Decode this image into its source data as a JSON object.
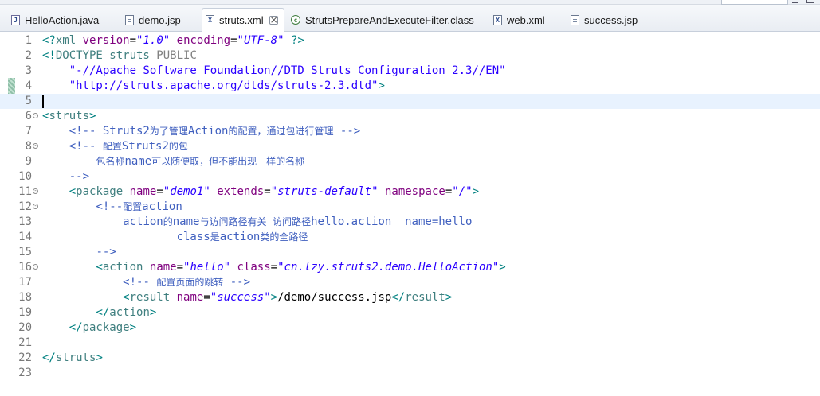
{
  "tabs": [
    {
      "label": "HelloAction.java",
      "icon": "java-file-icon",
      "active": false
    },
    {
      "label": "demo.jsp",
      "icon": "jsp-file-icon",
      "active": false
    },
    {
      "label": "struts.xml",
      "icon": "xml-file-icon",
      "active": true
    },
    {
      "label": "StrutsPrepareAndExecuteFilter.class",
      "icon": "class-file-icon",
      "active": false
    },
    {
      "label": "web.xml",
      "icon": "xml-file-icon",
      "active": false
    },
    {
      "label": "success.jsp",
      "icon": "jsp-file-icon",
      "active": false
    }
  ],
  "editor": {
    "current_line": 5,
    "lines": [
      {
        "n": "1",
        "fold": false,
        "segs": [
          [
            "t-br",
            "<?"
          ],
          [
            "t-tag",
            "xml"
          ],
          [
            "t-txt",
            " "
          ],
          [
            "t-attr",
            "version"
          ],
          [
            "t-txt",
            "="
          ],
          [
            "t-val",
            "\"1.0\""
          ],
          [
            "t-txt",
            " "
          ],
          [
            "t-attr",
            "encoding"
          ],
          [
            "t-txt",
            "="
          ],
          [
            "t-val",
            "\"UTF-8\""
          ],
          [
            "t-txt",
            " "
          ],
          [
            "t-br",
            "?>"
          ]
        ]
      },
      {
        "n": "2",
        "fold": false,
        "segs": [
          [
            "t-br",
            "<!"
          ],
          [
            "t-key",
            "DOCTYPE struts "
          ],
          [
            "t-dt",
            "PUBLIC"
          ]
        ]
      },
      {
        "n": "3",
        "fold": false,
        "segs": [
          [
            "t-txt",
            "    "
          ],
          [
            "t-str",
            "\"-//Apache Software Foundation//DTD Struts Configuration 2.3//EN\""
          ]
        ]
      },
      {
        "n": "4",
        "fold": false,
        "segs": [
          [
            "t-txt",
            "    "
          ],
          [
            "t-str",
            "\"http://struts.apache.org/dtds/struts-2.3.dtd\""
          ],
          [
            "t-br",
            ">"
          ]
        ]
      },
      {
        "n": "5",
        "fold": false,
        "segs": []
      },
      {
        "n": "6",
        "fold": true,
        "segs": [
          [
            "t-br",
            "<"
          ],
          [
            "t-tag",
            "struts"
          ],
          [
            "t-br",
            ">"
          ]
        ]
      },
      {
        "n": "7",
        "fold": false,
        "segs": [
          [
            "t-txt",
            "    "
          ],
          [
            "t-com",
            "<!-- Struts2"
          ],
          [
            "t-com cjk",
            "为了管理"
          ],
          [
            "t-com",
            "Action"
          ],
          [
            "t-com cjk",
            "的配置，通过包进行管理"
          ],
          [
            "t-com",
            " -->"
          ]
        ]
      },
      {
        "n": "8",
        "fold": true,
        "segs": [
          [
            "t-txt",
            "    "
          ],
          [
            "t-com",
            "<!-- "
          ],
          [
            "t-com cjk",
            "配置"
          ],
          [
            "t-com",
            "Struts2"
          ],
          [
            "t-com cjk",
            "的包"
          ]
        ]
      },
      {
        "n": "9",
        "fold": false,
        "segs": [
          [
            "t-txt",
            "        "
          ],
          [
            "t-com cjk",
            "包名称"
          ],
          [
            "t-com",
            "name"
          ],
          [
            "t-com cjk",
            "可以随便取，但不能出现一样的名称"
          ]
        ]
      },
      {
        "n": "10",
        "fold": false,
        "segs": [
          [
            "t-txt",
            "    "
          ],
          [
            "t-com",
            "-->"
          ]
        ]
      },
      {
        "n": "11",
        "fold": true,
        "segs": [
          [
            "t-txt",
            "    "
          ],
          [
            "t-br",
            "<"
          ],
          [
            "t-tag",
            "package"
          ],
          [
            "t-txt",
            " "
          ],
          [
            "t-attr",
            "name"
          ],
          [
            "t-txt",
            "="
          ],
          [
            "t-val",
            "\"demo1\""
          ],
          [
            "t-txt",
            " "
          ],
          [
            "t-attr",
            "extends"
          ],
          [
            "t-txt",
            "="
          ],
          [
            "t-val",
            "\"struts-default\""
          ],
          [
            "t-txt",
            " "
          ],
          [
            "t-attr",
            "namespace"
          ],
          [
            "t-txt",
            "="
          ],
          [
            "t-val",
            "\"/\""
          ],
          [
            "t-br",
            ">"
          ]
        ]
      },
      {
        "n": "12",
        "fold": true,
        "segs": [
          [
            "t-txt",
            "        "
          ],
          [
            "t-com",
            "<!--"
          ],
          [
            "t-com cjk",
            "配置"
          ],
          [
            "t-com",
            "action"
          ]
        ]
      },
      {
        "n": "13",
        "fold": false,
        "segs": [
          [
            "t-txt",
            "            "
          ],
          [
            "t-com",
            "action"
          ],
          [
            "t-com cjk",
            "的"
          ],
          [
            "t-com",
            "name"
          ],
          [
            "t-com cjk",
            "与访问路径有关  访问路径"
          ],
          [
            "t-com",
            "hello.action  name=hello"
          ]
        ]
      },
      {
        "n": "14",
        "fold": false,
        "segs": [
          [
            "t-txt",
            "                    "
          ],
          [
            "t-com",
            "class"
          ],
          [
            "t-com cjk",
            "是"
          ],
          [
            "t-com",
            "action"
          ],
          [
            "t-com cjk",
            "类的全路径"
          ]
        ]
      },
      {
        "n": "15",
        "fold": false,
        "segs": [
          [
            "t-txt",
            "        "
          ],
          [
            "t-com",
            "-->"
          ]
        ]
      },
      {
        "n": "16",
        "fold": true,
        "segs": [
          [
            "t-txt",
            "        "
          ],
          [
            "t-br",
            "<"
          ],
          [
            "t-tag",
            "action"
          ],
          [
            "t-txt",
            " "
          ],
          [
            "t-attr",
            "name"
          ],
          [
            "t-txt",
            "="
          ],
          [
            "t-val",
            "\"hello\""
          ],
          [
            "t-txt",
            " "
          ],
          [
            "t-attr",
            "class"
          ],
          [
            "t-txt",
            "="
          ],
          [
            "t-val",
            "\"cn.lzy.struts2.demo.HelloAction\""
          ],
          [
            "t-br",
            ">"
          ]
        ]
      },
      {
        "n": "17",
        "fold": false,
        "segs": [
          [
            "t-txt",
            "            "
          ],
          [
            "t-com",
            "<!-- "
          ],
          [
            "t-com cjk",
            "配置页面的跳转"
          ],
          [
            "t-com",
            " -->"
          ]
        ]
      },
      {
        "n": "18",
        "fold": false,
        "segs": [
          [
            "t-txt",
            "            "
          ],
          [
            "t-br",
            "<"
          ],
          [
            "t-tag",
            "result"
          ],
          [
            "t-txt",
            " "
          ],
          [
            "t-attr",
            "name"
          ],
          [
            "t-txt",
            "="
          ],
          [
            "t-val",
            "\"success\""
          ],
          [
            "t-br",
            ">"
          ],
          [
            "t-txt",
            "/demo/success.jsp"
          ],
          [
            "t-br",
            "</"
          ],
          [
            "t-tag",
            "result"
          ],
          [
            "t-br",
            ">"
          ]
        ]
      },
      {
        "n": "19",
        "fold": false,
        "segs": [
          [
            "t-txt",
            "        "
          ],
          [
            "t-br",
            "</"
          ],
          [
            "t-tag",
            "action"
          ],
          [
            "t-br",
            ">"
          ]
        ]
      },
      {
        "n": "20",
        "fold": false,
        "segs": [
          [
            "t-txt",
            "    "
          ],
          [
            "t-br",
            "</"
          ],
          [
            "t-tag",
            "package"
          ],
          [
            "t-br",
            ">"
          ]
        ]
      },
      {
        "n": "21",
        "fold": false,
        "segs": []
      },
      {
        "n": "22",
        "fold": false,
        "segs": [
          [
            "t-br",
            "</"
          ],
          [
            "t-tag",
            "struts"
          ],
          [
            "t-br",
            ">"
          ]
        ]
      },
      {
        "n": "23",
        "fold": false,
        "segs": []
      }
    ]
  }
}
